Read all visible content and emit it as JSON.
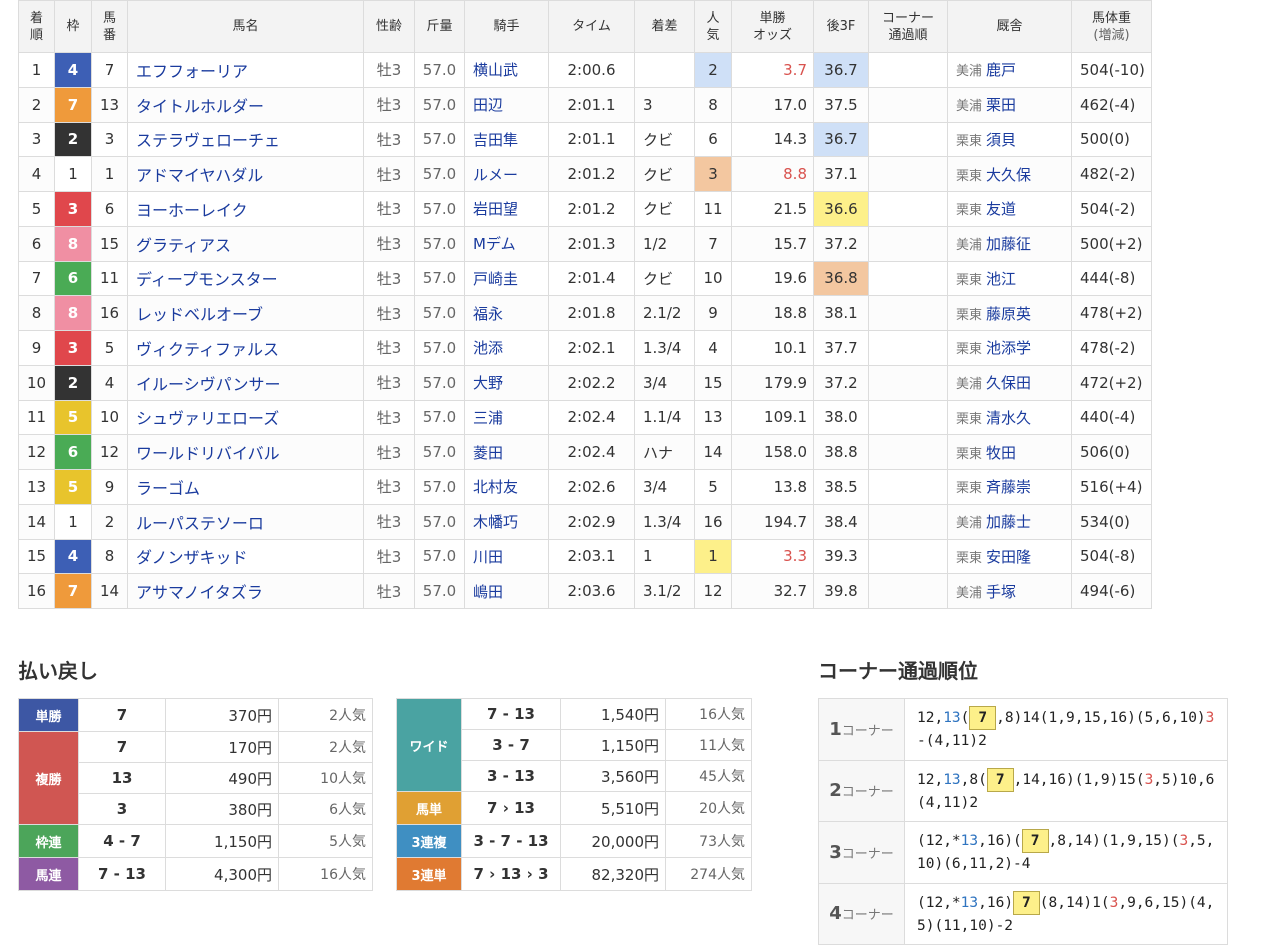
{
  "results": {
    "headers": {
      "rank": [
        "着",
        "順"
      ],
      "waku": "枠",
      "num": [
        "馬",
        "番"
      ],
      "name": "馬名",
      "sexage": "性齢",
      "weight": "斤量",
      "jockey": "騎手",
      "time": "タイム",
      "margin": "着差",
      "pop": [
        "人",
        "気"
      ],
      "odds": [
        "単勝",
        "オッズ"
      ],
      "last3f": "後3F",
      "corner": [
        "コーナー",
        "通過順"
      ],
      "stable": "厩舎",
      "bodyweight": [
        "馬体重",
        "(増減)"
      ]
    },
    "rows": [
      {
        "rank": "1",
        "waku": "4",
        "num": "7",
        "name": "エフフォーリア",
        "sexage": "牡3",
        "weight": "57.0",
        "jockey": "横山武",
        "time": "2:00.6",
        "margin": "",
        "pop": "2",
        "odds": "3.7",
        "last3f": "36.7",
        "corner": "",
        "region": "美浦",
        "trainer": "鹿戸",
        "bw": "504(-10)"
      },
      {
        "rank": "2",
        "waku": "7",
        "num": "13",
        "name": "タイトルホルダー",
        "sexage": "牡3",
        "weight": "57.0",
        "jockey": "田辺",
        "time": "2:01.1",
        "margin": "3",
        "pop": "8",
        "odds": "17.0",
        "last3f": "37.5",
        "corner": "",
        "region": "美浦",
        "trainer": "栗田",
        "bw": "462(-4)"
      },
      {
        "rank": "3",
        "waku": "2",
        "num": "3",
        "name": "ステラヴェローチェ",
        "sexage": "牡3",
        "weight": "57.0",
        "jockey": "吉田隼",
        "time": "2:01.1",
        "margin": "クビ",
        "pop": "6",
        "odds": "14.3",
        "last3f": "36.7",
        "corner": "",
        "region": "栗東",
        "trainer": "須貝",
        "bw": "500(0)"
      },
      {
        "rank": "4",
        "waku": "1",
        "num": "1",
        "name": "アドマイヤハダル",
        "sexage": "牡3",
        "weight": "57.0",
        "jockey": "ルメー",
        "time": "2:01.2",
        "margin": "クビ",
        "pop": "3",
        "odds": "8.8",
        "last3f": "37.1",
        "corner": "",
        "region": "栗東",
        "trainer": "大久保",
        "bw": "482(-2)"
      },
      {
        "rank": "5",
        "waku": "3",
        "num": "6",
        "name": "ヨーホーレイク",
        "sexage": "牡3",
        "weight": "57.0",
        "jockey": "岩田望",
        "time": "2:01.2",
        "margin": "クビ",
        "pop": "11",
        "odds": "21.5",
        "last3f": "36.6",
        "corner": "",
        "region": "栗東",
        "trainer": "友道",
        "bw": "504(-2)"
      },
      {
        "rank": "6",
        "waku": "8",
        "num": "15",
        "name": "グラティアス",
        "sexage": "牡3",
        "weight": "57.0",
        "jockey": "Mデム",
        "time": "2:01.3",
        "margin": "1/2",
        "pop": "7",
        "odds": "15.7",
        "last3f": "37.2",
        "corner": "",
        "region": "美浦",
        "trainer": "加藤征",
        "bw": "500(+2)"
      },
      {
        "rank": "7",
        "waku": "6",
        "num": "11",
        "name": "ディープモンスター",
        "sexage": "牡3",
        "weight": "57.0",
        "jockey": "戸崎圭",
        "time": "2:01.4",
        "margin": "クビ",
        "pop": "10",
        "odds": "19.6",
        "last3f": "36.8",
        "corner": "",
        "region": "栗東",
        "trainer": "池江",
        "bw": "444(-8)"
      },
      {
        "rank": "8",
        "waku": "8",
        "num": "16",
        "name": "レッドベルオーブ",
        "sexage": "牡3",
        "weight": "57.0",
        "jockey": "福永",
        "time": "2:01.8",
        "margin": "2.1/2",
        "pop": "9",
        "odds": "18.8",
        "last3f": "38.1",
        "corner": "",
        "region": "栗東",
        "trainer": "藤原英",
        "bw": "478(+2)"
      },
      {
        "rank": "9",
        "waku": "3",
        "num": "5",
        "name": "ヴィクティファルス",
        "sexage": "牡3",
        "weight": "57.0",
        "jockey": "池添",
        "time": "2:02.1",
        "margin": "1.3/4",
        "pop": "4",
        "odds": "10.1",
        "last3f": "37.7",
        "corner": "",
        "region": "栗東",
        "trainer": "池添学",
        "bw": "478(-2)"
      },
      {
        "rank": "10",
        "waku": "2",
        "num": "4",
        "name": "イルーシヴパンサー",
        "sexage": "牡3",
        "weight": "57.0",
        "jockey": "大野",
        "time": "2:02.2",
        "margin": "3/4",
        "pop": "15",
        "odds": "179.9",
        "last3f": "37.2",
        "corner": "",
        "region": "美浦",
        "trainer": "久保田",
        "bw": "472(+2)"
      },
      {
        "rank": "11",
        "waku": "5",
        "num": "10",
        "name": "シュヴァリエローズ",
        "sexage": "牡3",
        "weight": "57.0",
        "jockey": "三浦",
        "time": "2:02.4",
        "margin": "1.1/4",
        "pop": "13",
        "odds": "109.1",
        "last3f": "38.0",
        "corner": "",
        "region": "栗東",
        "trainer": "清水久",
        "bw": "440(-4)"
      },
      {
        "rank": "12",
        "waku": "6",
        "num": "12",
        "name": "ワールドリバイバル",
        "sexage": "牡3",
        "weight": "57.0",
        "jockey": "菱田",
        "time": "2:02.4",
        "margin": "ハナ",
        "pop": "14",
        "odds": "158.0",
        "last3f": "38.8",
        "corner": "",
        "region": "栗東",
        "trainer": "牧田",
        "bw": "506(0)"
      },
      {
        "rank": "13",
        "waku": "5",
        "num": "9",
        "name": "ラーゴム",
        "sexage": "牡3",
        "weight": "57.0",
        "jockey": "北村友",
        "time": "2:02.6",
        "margin": "3/4",
        "pop": "5",
        "odds": "13.8",
        "last3f": "38.5",
        "corner": "",
        "region": "栗東",
        "trainer": "斉藤崇",
        "bw": "516(+4)"
      },
      {
        "rank": "14",
        "waku": "1",
        "num": "2",
        "name": "ルーパステソーロ",
        "sexage": "牡3",
        "weight": "57.0",
        "jockey": "木幡巧",
        "time": "2:02.9",
        "margin": "1.3/4",
        "pop": "16",
        "odds": "194.7",
        "last3f": "38.4",
        "corner": "",
        "region": "美浦",
        "trainer": "加藤士",
        "bw": "534(0)"
      },
      {
        "rank": "15",
        "waku": "4",
        "num": "8",
        "name": "ダノンザキッド",
        "sexage": "牡3",
        "weight": "57.0",
        "jockey": "川田",
        "time": "2:03.1",
        "margin": "1",
        "pop": "1",
        "odds": "3.3",
        "last3f": "39.3",
        "corner": "",
        "region": "栗東",
        "trainer": "安田隆",
        "bw": "504(-8)"
      },
      {
        "rank": "16",
        "waku": "7",
        "num": "14",
        "name": "アサマノイタズラ",
        "sexage": "牡3",
        "weight": "57.0",
        "jockey": "嶋田",
        "time": "2:03.6",
        "margin": "3.1/2",
        "pop": "12",
        "odds": "32.7",
        "last3f": "39.8",
        "corner": "",
        "region": "美浦",
        "trainer": "手塚",
        "bw": "494(-6)"
      }
    ]
  },
  "payout": {
    "title": "払い戻し",
    "left": [
      {
        "label": "単勝",
        "color": "#3d57a4",
        "entries": [
          {
            "combo": "7",
            "amount": "370円",
            "pop": "2人気"
          }
        ]
      },
      {
        "label": "複勝",
        "color": "#d05652",
        "entries": [
          {
            "combo": "7",
            "amount": "170円",
            "pop": "2人気"
          },
          {
            "combo": "13",
            "amount": "490円",
            "pop": "10人気"
          },
          {
            "combo": "3",
            "amount": "380円",
            "pop": "6人気"
          }
        ]
      },
      {
        "label": "枠連",
        "color": "#4ca55a",
        "entries": [
          {
            "combo": "4 - 7",
            "amount": "1,150円",
            "pop": "5人気"
          }
        ]
      },
      {
        "label": "馬連",
        "color": "#8e5aa3",
        "entries": [
          {
            "combo": "7 - 13",
            "amount": "4,300円",
            "pop": "16人気"
          }
        ]
      }
    ],
    "right": [
      {
        "label": "ワイド",
        "color": "#4aa3a2",
        "entries": [
          {
            "combo": "7 - 13",
            "amount": "1,540円",
            "pop": "16人気"
          },
          {
            "combo": "3 - 7",
            "amount": "1,150円",
            "pop": "11人気"
          },
          {
            "combo": "3 - 13",
            "amount": "3,560円",
            "pop": "45人気"
          }
        ]
      },
      {
        "label": "馬単",
        "color": "#e0a033",
        "entries": [
          {
            "combo": "7 › 13",
            "amount": "5,510円",
            "pop": "20人気"
          }
        ]
      },
      {
        "label": "3連複",
        "color": "#3f8fc2",
        "entries": [
          {
            "combo": "3 - 7 - 13",
            "amount": "20,000円",
            "pop": "73人気"
          }
        ]
      },
      {
        "label": "3連単",
        "color": "#e07a32",
        "entries": [
          {
            "combo": "7 › 13 › 3",
            "amount": "82,320円",
            "pop": "274人気"
          }
        ]
      }
    ]
  },
  "corners": {
    "title": "コーナー通過順位",
    "suffix": "コーナー",
    "rows": [
      {
        "n": "1",
        "segments": [
          {
            "t": "12,"
          },
          {
            "t": "13",
            "c": "blue"
          },
          {
            "t": "(",
            "box": false
          },
          {
            "t": "7",
            "box": true
          },
          {
            "t": ",8)14(1,9,15,16)(5,6,10)"
          },
          {
            "t": "3",
            "c": "red"
          },
          {
            "t": "-(4,11)2"
          }
        ]
      },
      {
        "n": "2",
        "segments": [
          {
            "t": "12,"
          },
          {
            "t": "13",
            "c": "blue"
          },
          {
            "t": ",8("
          },
          {
            "t": "7",
            "box": true
          },
          {
            "t": ",14,16)(1,9)15("
          },
          {
            "t": "3",
            "c": "red"
          },
          {
            "t": ",5)10,6(4,11)2"
          }
        ]
      },
      {
        "n": "3",
        "segments": [
          {
            "t": "(12,*"
          },
          {
            "t": "13",
            "c": "blue"
          },
          {
            "t": ",16)("
          },
          {
            "t": "7",
            "box": true
          },
          {
            "t": ",8,14)(1,9,15)("
          },
          {
            "t": "3",
            "c": "red"
          },
          {
            "t": ",5,10)(6,11,2)-4"
          }
        ]
      },
      {
        "n": "4",
        "segments": [
          {
            "t": "(12,*"
          },
          {
            "t": "13",
            "c": "blue"
          },
          {
            "t": ",16)"
          },
          {
            "t": "7",
            "box": true
          },
          {
            "t": "(8,14)1("
          },
          {
            "t": "3",
            "c": "red"
          },
          {
            "t": ",9,6,15)(4,5)(11,10)-2"
          }
        ]
      }
    ]
  },
  "waku_colors": {
    "1": {
      "bg": "#ffffff",
      "fg": "#333333"
    },
    "2": {
      "bg": "#333333",
      "fg": "#ffffff"
    },
    "3": {
      "bg": "#e0474c",
      "fg": "#ffffff"
    },
    "4": {
      "bg": "#3d5fb5",
      "fg": "#ffffff"
    },
    "5": {
      "bg": "#e8c42c",
      "fg": "#ffffff"
    },
    "6": {
      "bg": "#4aab55",
      "fg": "#ffffff"
    },
    "7": {
      "bg": "#ef9a3b",
      "fg": "#ffffff"
    },
    "8": {
      "bg": "#f08fa3",
      "fg": "#ffffff"
    }
  },
  "highlights": {
    "pop": {
      "1": "hl-yellow",
      "2": "hl-blue",
      "3": "hl-orange"
    },
    "last3f": {
      "1": "hl-yellow",
      "2": "hl-blue",
      "3": "hl-orange"
    }
  }
}
